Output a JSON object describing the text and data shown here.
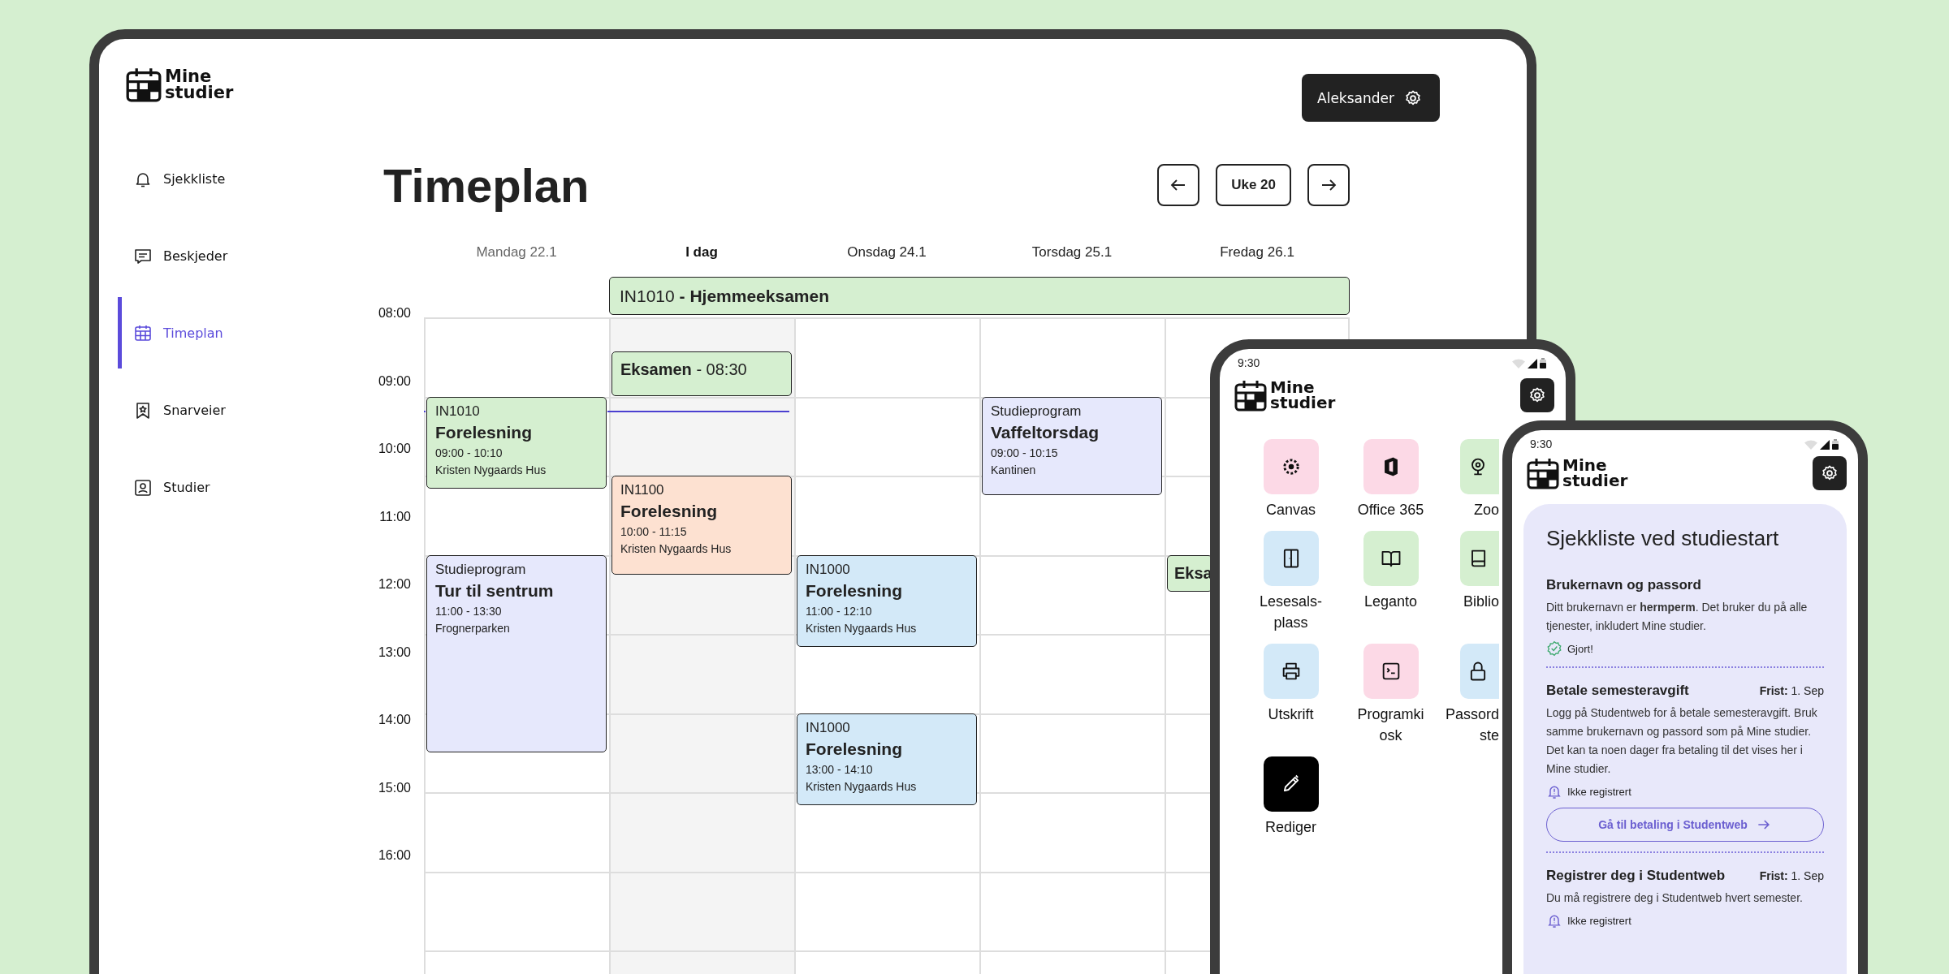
{
  "tablet": {
    "brand": "Mine studier",
    "user_button": "Aleksander",
    "nav": [
      {
        "label": "Sjekkliste",
        "selected": false
      },
      {
        "label": "Beskjeder",
        "selected": false
      },
      {
        "label": "Timeplan",
        "selected": true
      },
      {
        "label": "Snarveier",
        "selected": false
      },
      {
        "label": "Studier",
        "selected": false
      }
    ],
    "title": "Timeplan",
    "week": "Uke 20",
    "hours": [
      "08:00",
      "09:00",
      "10:00",
      "11:00",
      "12:00",
      "13:00",
      "14:00",
      "15:00",
      "16:00"
    ],
    "days": [
      {
        "label": "Mandag 22.1",
        "today": false,
        "events": [
          {
            "course": "IN1010",
            "title": "Forelesning",
            "time": "09:00 - 10:10",
            "place": "Kristen Nygaards Hus",
            "color": "#d5efd0"
          },
          {
            "course": "Studieprogram",
            "title": "Tur til sentrum",
            "time": "11:00 - 13:30",
            "place": "Frognerparken",
            "color": "#e6e8fc"
          }
        ]
      },
      {
        "label": "I dag",
        "today": true,
        "all_day": {
          "title": "IN1010 **- Hjemmeeksamen**",
          "color": "#d5efd0"
        },
        "events": [
          {
            "title": "**Eksamen** - 08:30",
            "color": "#d5efd0"
          },
          {
            "course": "IN1100",
            "title": "Forelesning",
            "time": "10:00 - 11:15",
            "place": "Kristen Nygaards Hus",
            "color": "#fde1d1"
          }
        ]
      },
      {
        "label": "Onsdag 24.1",
        "today": false,
        "events": [
          {
            "course": "IN1000",
            "title": "Forelesning",
            "time": "11:00 - 12:10",
            "place": "Kristen Nygaards Hus",
            "color": "#d3e9f8"
          },
          {
            "course": "IN1000",
            "title": "Forelesning",
            "time": "13:00 - 14:10",
            "place": "Kristen Nygaards Hus",
            "color": "#d3e9f8"
          }
        ]
      },
      {
        "label": "Torsdag 25.1",
        "today": false,
        "events": [
          {
            "course": "Studieprogram",
            "title": "Vaffeltorsdag",
            "time": "09:00 - 10:15",
            "place": "Kantinen",
            "color": "#e6e8fc"
          }
        ]
      },
      {
        "label": "Fredag 26.1",
        "today": false,
        "events": [
          {
            "title": "**Eksa**",
            "color": "#d5efd0"
          }
        ]
      }
    ]
  },
  "apps_phone": {
    "time": "9:30",
    "brand": "Mine studier",
    "apps": [
      {
        "label_lines": [
          "Canvas"
        ],
        "color": "#fcd9e6"
      },
      {
        "label_lines": [
          "Office 365"
        ],
        "color": "#fcd9e6"
      },
      {
        "label_lines": [
          "Zoo"
        ],
        "color": "#d5efd0"
      },
      {
        "label_lines": [
          "Lesesals-",
          "plass"
        ],
        "color": "#d3e9f8"
      },
      {
        "label_lines": [
          "Leganto"
        ],
        "color": "#d5efd0"
      },
      {
        "label_lines": [
          "Biblio"
        ],
        "color": "#d5efd0"
      },
      {
        "label_lines": [
          "Utskrift"
        ],
        "color": "#d3e9f8"
      },
      {
        "label_lines": [
          "Programki",
          "osk"
        ],
        "color": "#fcd9e6"
      },
      {
        "label_lines": [
          "Passord",
          "ste"
        ],
        "color": "#d3e9f8"
      },
      {
        "label_lines": [
          "Rediger"
        ],
        "color": "#000000"
      }
    ]
  },
  "checklist_phone": {
    "time": "9:30",
    "brand": "Mine studier",
    "card": {
      "title": "Sjekkliste ved studiestart",
      "items": [
        {
          "title": "Brukernavn og passord",
          "text": "Ditt brukernavn er **hermperm**. Det bruker du på alle tjenester, inkludert Mine studier.",
          "status": {
            "done": true,
            "label": "Gjort!"
          }
        },
        {
          "title": "Betale semesteravgift",
          "deadline": "**Frist:** 1. Sep",
          "text": "Logg på Studentweb for å betale semesteravgift. Bruk samme brukernavn og passord som på Mine studier. Det kan ta noen dager fra betaling til det vises her i Mine studier.",
          "status": {
            "done": false,
            "label": "Ikke registrert"
          },
          "button": "Gå til betaling i Studentweb"
        },
        {
          "title": "Registrer deg i Studentweb",
          "deadline": "**Frist:** 1. Sep",
          "text": "Du må registrere deg i Studentweb hvert semester.",
          "status": {
            "done": false,
            "label": "Ikke registrert"
          }
        }
      ]
    }
  }
}
